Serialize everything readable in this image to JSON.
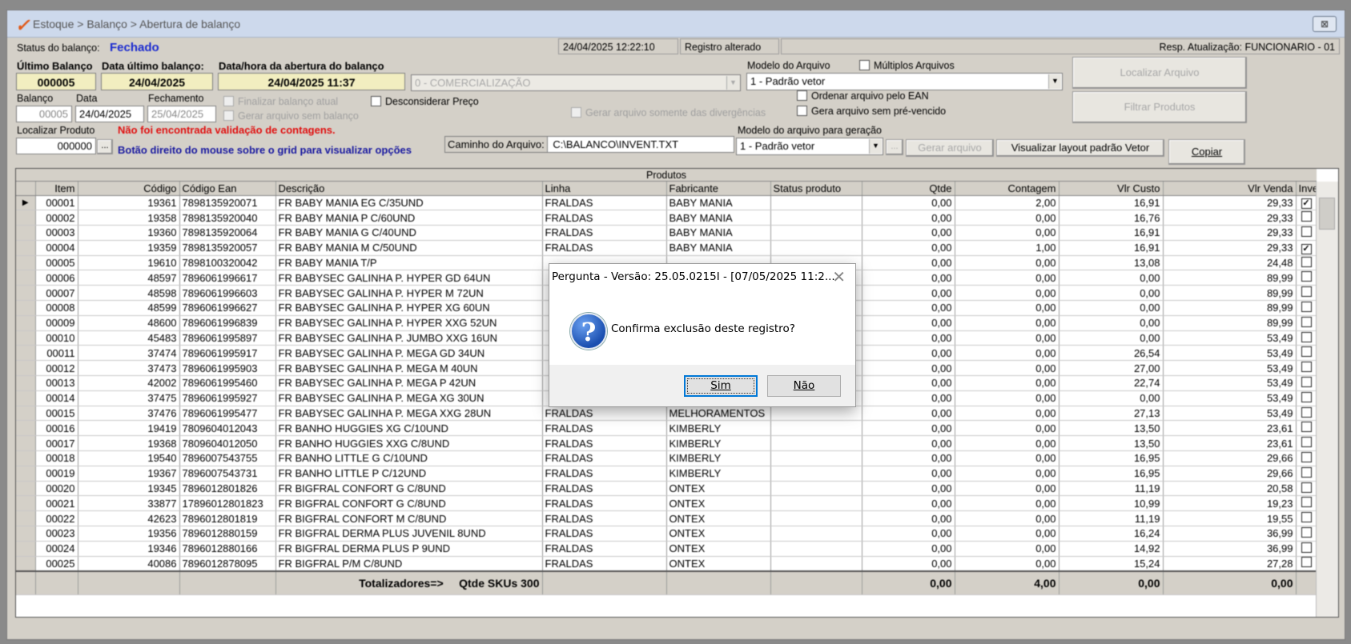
{
  "window": {
    "title": "Estoque > Balanço > Abertura de balanço",
    "close_label": "⊠"
  },
  "header": {
    "status_label": "Status do balanço:",
    "status_value": "Fechado",
    "datetime": "24/04/2025 12:22:10",
    "registro": "Registro alterado",
    "resp": "Resp. Atualização: FUNCIONARIO - 01"
  },
  "form": {
    "ultimo_balanco_label": "Último Balanço",
    "ultimo_balanco_value": "000005",
    "data_ultimo_label": "Data último balanço:",
    "data_ultimo_value": "24/04/2025",
    "abertura_label": "Data/hora da abertura do balanço",
    "abertura_value": "24/04/2025 11:37",
    "comercializacao": "0 - COMERCIALIZAÇÃO",
    "modelo_arquivo_label": "Modelo do Arquivo",
    "multiplos_label": "Múltiplos Arquivos",
    "modelo_arquivo_value": "1 - Padrão vetor",
    "localizar_arquivo": "Localizar Arquivo",
    "balanco_label": "Balanço",
    "balanco_value": "00005",
    "data_label": "Data",
    "data_value": "24/04/2025",
    "fechamento_label": "Fechamento",
    "fechamento_value": "25/04/2025",
    "finalizar_label": "Finalizar balanço atual",
    "gerar_sem_balanco": "Gerar arquivo sem balanço",
    "desconsiderar_preco": "Desconsiderar Preço",
    "gerar_divergencias": "Gerar arquivo somente das divergências",
    "ordenar_ean": "Ordenar arquivo pelo EAN",
    "sem_pre_vencido": "Gera arquivo sem pré-vencido",
    "filtrar_produtos": "Filtrar Produtos",
    "localizar_produto_label": "Localizar Produto",
    "localizar_produto_value": "000000",
    "ellipsis": "...",
    "aviso_vermelho": "Não foi encontrada validação de contagens.",
    "aviso_azul": "Botão direito do mouse sobre o grid para visualizar opções",
    "caminho_label": "Caminho do Arquivo:",
    "caminho_value": "C:\\BALANCO\\INVENT.TXT",
    "modelo_geracao_label": "Modelo do arquivo para geração",
    "modelo_geracao_value": "1 - Padrão vetor",
    "gerar_arquivo": "Gerar arquivo",
    "visualizar_layout": "Visualizar layout padrão Vetor",
    "copiar": "Copiar"
  },
  "grid": {
    "caption": "Produtos",
    "headers": [
      "",
      "Item",
      "Código",
      "Código Ean",
      "Descrição",
      "Linha",
      "Fabricante",
      "Status produto",
      "Qtde",
      "Contagem",
      "Vlr Custo",
      "Vlr Venda",
      "Inve"
    ],
    "rows": [
      [
        "00001",
        "19361",
        "7898135920071",
        "FR BABY MANIA  EG C/35UND",
        "FRALDAS",
        "BABY MANIA",
        "",
        "0,00",
        "2,00",
        "16,91",
        "29,33",
        "x"
      ],
      [
        "00002",
        "19358",
        "7898135920040",
        "FR BABY MANIA  P C/60UND",
        "FRALDAS",
        "BABY MANIA",
        "",
        "0,00",
        "0,00",
        "16,76",
        "29,33",
        ""
      ],
      [
        "00003",
        "19360",
        "7898135920064",
        "FR BABY MANIA G C/40UND",
        "FRALDAS",
        "BABY MANIA",
        "",
        "0,00",
        "0,00",
        "16,91",
        "29,33",
        ""
      ],
      [
        "00004",
        "19359",
        "7898135920057",
        "FR BABY MANIA M C/50UND",
        "FRALDAS",
        "BABY MANIA",
        "",
        "0,00",
        "1,00",
        "16,91",
        "29,33",
        "x"
      ],
      [
        "00005",
        "19610",
        "7898100320042",
        "FR BABY MANIA T/P",
        "",
        "",
        "",
        "0,00",
        "0,00",
        "13,08",
        "24,48",
        ""
      ],
      [
        "00006",
        "48597",
        "7896061996617",
        "FR BABYSEC GALINHA P. HYPER GD 64UN",
        "",
        "",
        "",
        "0,00",
        "0,00",
        "0,00",
        "89,99",
        ""
      ],
      [
        "00007",
        "48598",
        "7896061996603",
        "FR BABYSEC GALINHA P. HYPER M 72UN",
        "",
        "",
        "",
        "0,00",
        "0,00",
        "0,00",
        "89,99",
        ""
      ],
      [
        "00008",
        "48599",
        "7896061996627",
        "FR BABYSEC GALINHA P. HYPER XG 60UN",
        "",
        "",
        "",
        "0,00",
        "0,00",
        "0,00",
        "89,99",
        ""
      ],
      [
        "00009",
        "48600",
        "7896061996839",
        "FR BABYSEC GALINHA P. HYPER XXG 52UN",
        "",
        "",
        "",
        "0,00",
        "0,00",
        "0,00",
        "89,99",
        ""
      ],
      [
        "00010",
        "45483",
        "7896061995897",
        "FR BABYSEC GALINHA P. JUMBO XXG 16UN",
        "",
        "",
        "",
        "0,00",
        "0,00",
        "0,00",
        "53,49",
        ""
      ],
      [
        "00011",
        "37474",
        "7896061995917",
        "FR BABYSEC GALINHA P. MEGA GD 34UN",
        "",
        "",
        "",
        "0,00",
        "0,00",
        "26,54",
        "53,49",
        ""
      ],
      [
        "00012",
        "37473",
        "7896061995903",
        "FR BABYSEC GALINHA P. MEGA M 40UN",
        "",
        "",
        "",
        "0,00",
        "0,00",
        "27,00",
        "53,49",
        ""
      ],
      [
        "00013",
        "42002",
        "7896061995460",
        "FR BABYSEC GALINHA P. MEGA P 42UN",
        "",
        "",
        "",
        "0,00",
        "0,00",
        "22,74",
        "53,49",
        ""
      ],
      [
        "00014",
        "37475",
        "7896061995927",
        "FR BABYSEC GALINHA P. MEGA XG 30UN",
        "",
        "",
        "",
        "0,00",
        "0,00",
        "0,00",
        "53,49",
        ""
      ],
      [
        "00015",
        "37476",
        "7896061995477",
        "FR BABYSEC GALINHA P. MEGA XXG 28UN",
        "FRALDAS",
        "MELHORAMENTOS",
        "",
        "0,00",
        "0,00",
        "27,13",
        "53,49",
        ""
      ],
      [
        "00016",
        "19419",
        "7809604012043",
        "FR BANHO HUGGIES XG C/10UND",
        "FRALDAS",
        "KIMBERLY",
        "",
        "0,00",
        "0,00",
        "13,50",
        "23,61",
        ""
      ],
      [
        "00017",
        "19368",
        "7809604012050",
        "FR BANHO HUGGIES XXG C/8UND",
        "FRALDAS",
        "KIMBERLY",
        "",
        "0,00",
        "0,00",
        "13,50",
        "23,61",
        ""
      ],
      [
        "00018",
        "19540",
        "7896007543755",
        "FR BANHO LITTLE G C/10UND",
        "FRALDAS",
        "KIMBERLY",
        "",
        "0,00",
        "0,00",
        "16,95",
        "29,66",
        ""
      ],
      [
        "00019",
        "19367",
        "7896007543731",
        "FR BANHO LITTLE P C/12UND",
        "FRALDAS",
        "KIMBERLY",
        "",
        "0,00",
        "0,00",
        "16,95",
        "29,66",
        ""
      ],
      [
        "00020",
        "19345",
        "7896012801826",
        "FR BIGFRAL CONFORT G C/8UND",
        "FRALDAS",
        "ONTEX",
        "",
        "0,00",
        "0,00",
        "11,19",
        "20,58",
        ""
      ],
      [
        "00021",
        "33877",
        "17896012801823",
        "FR BIGFRAL CONFORT G C/8UND",
        "FRALDAS",
        "ONTEX",
        "",
        "0,00",
        "0,00",
        "10,99",
        "19,23",
        ""
      ],
      [
        "00022",
        "42623",
        "7896012801819",
        "FR BIGFRAL CONFORT M C/8UND",
        "FRALDAS",
        "ONTEX",
        "",
        "0,00",
        "0,00",
        "11,19",
        "19,55",
        ""
      ],
      [
        "00023",
        "19356",
        "7896012880159",
        "FR BIGFRAL DERMA PLUS JUVENIL 8UND",
        "FRALDAS",
        "ONTEX",
        "",
        "0,00",
        "0,00",
        "16,24",
        "36,99",
        ""
      ],
      [
        "00024",
        "19346",
        "7896012880166",
        "FR BIGFRAL DERMA PLUS P 9UND",
        "FRALDAS",
        "ONTEX",
        "",
        "0,00",
        "0,00",
        "14,92",
        "36,99",
        ""
      ],
      [
        "00025",
        "40086",
        "7896012878095",
        "FR BIGFRAL P/M C/8UND",
        "FRALDAS",
        "ONTEX",
        "",
        "0,00",
        "0,00",
        "15,24",
        "27,28",
        ""
      ]
    ],
    "totals": {
      "label": "Totalizadores=>",
      "skus": "Qtde SKUs 300",
      "qtde": "0,00",
      "contagem": "4,00",
      "custo": "0,00",
      "venda": "0,00"
    }
  },
  "dialog": {
    "title": "Pergunta - Versão: 25.05.0215I - [07/05/2025 11:2...",
    "close": "✕",
    "message": "Confirma exclusão deste registro?",
    "icon": "question-icon",
    "yes": "Sim",
    "no": "Não"
  },
  "colors": {
    "status_blue": "#1a2ad0",
    "warning_red": "#e01010",
    "hint_blue": "#1a1aa0",
    "field_yellow": "#f2eec0"
  }
}
